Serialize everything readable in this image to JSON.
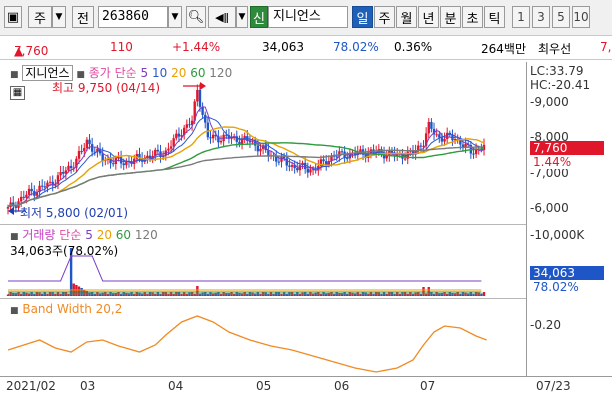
{
  "toolbar": {
    "market_label": "주",
    "type_label": "전",
    "code_value": "263860",
    "stock_name": "지니언스",
    "credit_label": "신",
    "periods": [
      "일",
      "주",
      "월",
      "년",
      "분",
      "초",
      "틱"
    ],
    "active_period": "일",
    "intervals": [
      "1",
      "3",
      "5",
      "10"
    ]
  },
  "quote": {
    "price": "7,760",
    "change_arrow": "▲",
    "change": "110",
    "change_pct": "+1.44%",
    "volume": "34,063",
    "volume_ratio": "78.02%",
    "turnover_pct": "0.36%",
    "amount": "264백만",
    "best_ask_label": "최우선",
    "best_ask_value": "7,"
  },
  "price_panel": {
    "name": "지니언스",
    "ma_title": "종가 단순",
    "ma_periods": [
      "5",
      "10",
      "20",
      "60",
      "120"
    ],
    "high_note": "최고 9,750 (04/14)",
    "low_note": "최저 5,800 (02/01)",
    "lc": "LC:33.79",
    "hc": "HC:-20.41",
    "y_ticks": [
      "9,000",
      "8,000",
      "7,000",
      "6,000"
    ],
    "last_price": "7,760",
    "last_pct": "1.44%"
  },
  "volume_panel": {
    "title": "거래량",
    "ma_title": "단순",
    "ma_periods": [
      "5",
      "20",
      "60",
      "120"
    ],
    "value_text": "34,063주(78.02%)",
    "y_tick": "10,000K",
    "last_volume": "34,063",
    "last_ratio": "78.02%"
  },
  "band_panel": {
    "title": "Band Width 20,2",
    "y_tick": "0.20"
  },
  "x_axis": {
    "labels": [
      "2021/02",
      "03",
      "04",
      "05",
      "06",
      "07"
    ],
    "date": "07/23"
  },
  "colors": {
    "up": "#e0162b",
    "down": "#1f56c7",
    "ma5": "#7b3fc4",
    "ma10": "#2b59d1",
    "ma20": "#e6a200",
    "ma60": "#2e9b3e",
    "ma120": "#7a7a7a",
    "band": "#f08a24"
  }
}
